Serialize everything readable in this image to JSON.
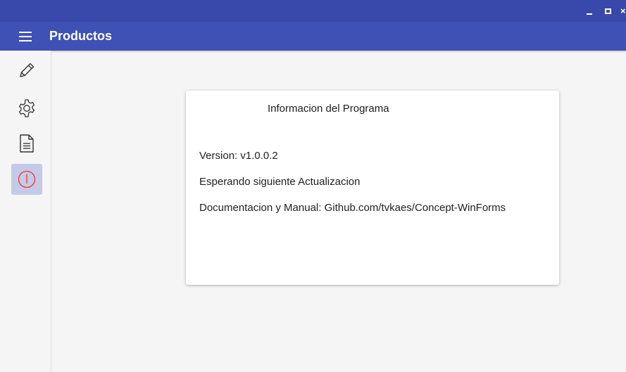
{
  "window": {
    "minimize_label": "_",
    "close_label": "×"
  },
  "appbar": {
    "title": "Productos",
    "menu_icon": "hamburger-menu-icon"
  },
  "sidebar": {
    "items": [
      {
        "icon": "pencil-icon",
        "active": false
      },
      {
        "icon": "gear-icon",
        "active": false
      },
      {
        "icon": "document-icon",
        "active": false
      },
      {
        "icon": "info-icon",
        "active": true
      }
    ]
  },
  "info_card": {
    "title": "Informacion del Programa",
    "version": "Version: v1.0.0.2",
    "status": "Esperando siguiente Actualizacion",
    "docs": "Documentacion y Manual: Github.com/tvkaes/Concept-WinForms"
  },
  "colors": {
    "titlebar": "#3949ab",
    "appbar": "#3f51b5",
    "active_nav_bg": "#c5cae9",
    "info_icon": "#e53935"
  }
}
